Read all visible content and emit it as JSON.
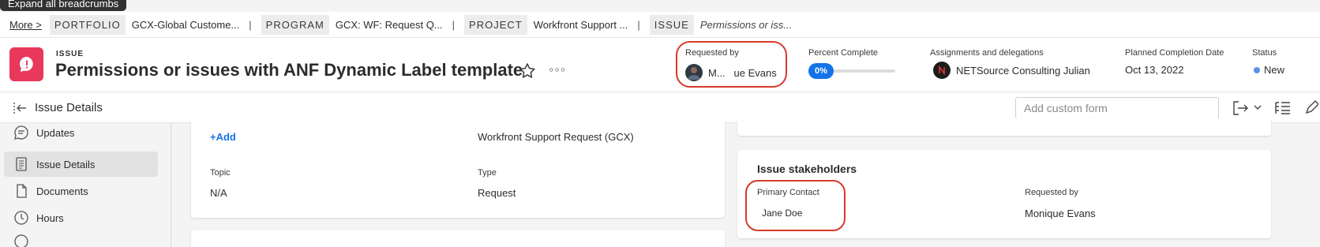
{
  "tooltip": "Expand all breadcrumbs",
  "breadcrumbs": {
    "more": "More >",
    "items": [
      {
        "type": "PORTFOLIO",
        "name": "GCX-Global Custome..."
      },
      {
        "type": "PROGRAM",
        "name": "GCX: WF: Request Q..."
      },
      {
        "type": "PROJECT",
        "name": "Workfront Support ..."
      },
      {
        "type": "ISSUE",
        "name": "Permissions or iss..."
      }
    ],
    "separator": "|"
  },
  "header": {
    "object_type": "ISSUE",
    "title": "Permissions or issues with ANF Dynamic Label template",
    "more_glyph": "◦◦◦",
    "requested_by_label": "Requested by",
    "requested_by_value": "M...   ue Evans",
    "percent_label": "Percent Complete",
    "percent_value": "0%",
    "percent": 0,
    "assign_label": "Assignments and delegations",
    "assign_value": "NETSource Consulting Julian",
    "planned_label": "Planned Completion Date",
    "planned_value": "Oct 13, 2022",
    "status_label": "Status",
    "status_value": "New"
  },
  "toolbar": {
    "title": "Issue Details",
    "custom_form_placeholder": "Add custom form"
  },
  "nav": {
    "items": [
      {
        "label": "Updates",
        "icon": "chat-bubble-icon"
      },
      {
        "label": "Issue Details",
        "icon": "document-list-icon"
      },
      {
        "label": "Documents",
        "icon": "document-icon"
      },
      {
        "label": "Hours",
        "icon": "clock-icon"
      }
    ]
  },
  "details_card": {
    "add_link": "+Add",
    "request_form_value": "Workfront Support Request (GCX)",
    "topic_label": "Topic",
    "topic_value": "N/A",
    "type_label": "Type",
    "type_value": "Request"
  },
  "stakeholders_card": {
    "title": "Issue stakeholders",
    "primary_contact_label": "Primary Contact",
    "primary_contact_value": "Jane Doe",
    "requested_by_label": "Requested by",
    "requested_by_value": "Monique Evans"
  },
  "colors": {
    "issue_icon": "#e8385b",
    "accent": "#1473e6",
    "annotation": "#d63a2b",
    "status_new": "#5b8fe8"
  }
}
